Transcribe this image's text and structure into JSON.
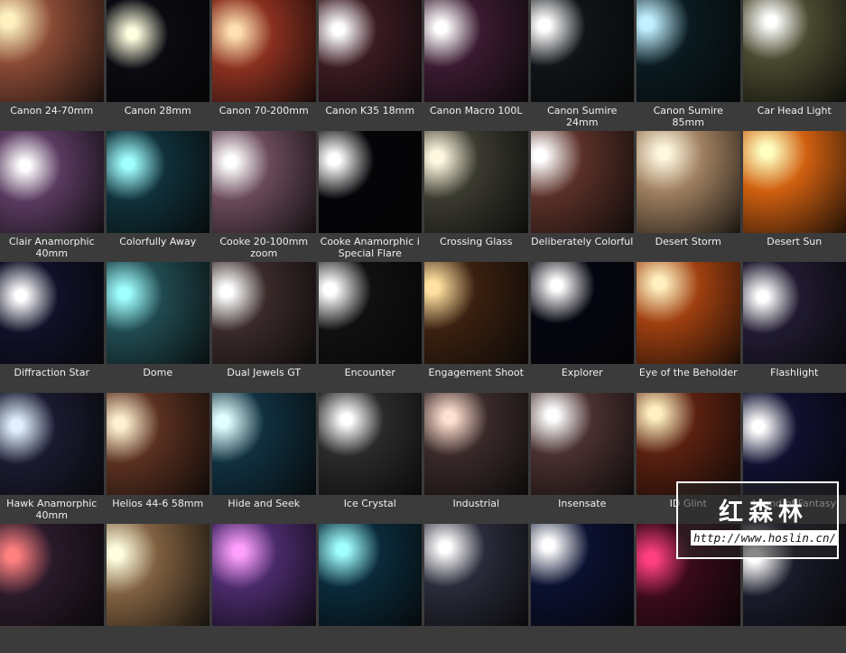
{
  "presets": [
    {
      "label": "Canon 24-70mm",
      "glow": "#fff2c0",
      "bg": "#8a4a35"
    },
    {
      "label": "Canon 28mm",
      "glow": "#ffffe0",
      "bg": "#0a0a10"
    },
    {
      "label": "Canon 70-200mm",
      "glow": "#ffe0b0",
      "bg": "#8a3020"
    },
    {
      "label": "Canon K35 18mm",
      "glow": "#ffffff",
      "bg": "#3a1a22"
    },
    {
      "label": "Canon Macro 100L",
      "glow": "#ffffff",
      "bg": "#3a1a30"
    },
    {
      "label": "Canon Sumire 24mm",
      "glow": "#ffffff",
      "bg": "#101418"
    },
    {
      "label": "Canon Sumire 85mm",
      "glow": "#c0f0ff",
      "bg": "#0a1a20"
    },
    {
      "label": "Car Head Light",
      "glow": "#ffffff",
      "bg": "#4a4a30"
    },
    {
      "label": "Clair Anamorphic 40mm",
      "glow": "#ffffff",
      "bg": "#5a3a60"
    },
    {
      "label": "Colorfully Away",
      "glow": "#a0ffff",
      "bg": "#10303a"
    },
    {
      "label": "Cooke 20-100mm zoom",
      "glow": "#ffffff",
      "bg": "#6a4a5a"
    },
    {
      "label": "Cooke Anamorphic i Special Flare",
      "glow": "#ffffff",
      "bg": "#050508"
    },
    {
      "label": "Crossing Glass",
      "glow": "#fff8e0",
      "bg": "#3a3a30"
    },
    {
      "label": "Deliberately Colorful",
      "glow": "#ffffff",
      "bg": "#5a3028"
    },
    {
      "label": "Desert Storm",
      "glow": "#fff8e0",
      "bg": "#a08060"
    },
    {
      "label": "Desert Sun",
      "glow": "#ffffc0",
      "bg": "#d06010"
    },
    {
      "label": "Diffraction Star",
      "glow": "#ffffff",
      "bg": "#101028"
    },
    {
      "label": "Dome",
      "glow": "#a0ffff",
      "bg": "#204a50"
    },
    {
      "label": "Dual Jewels GT",
      "glow": "#ffffff",
      "bg": "#3a2a2a"
    },
    {
      "label": "Encounter",
      "glow": "#ffffff",
      "bg": "#101010"
    },
    {
      "label": "Engagement Shoot",
      "glow": "#ffe0a0",
      "bg": "#3a2010"
    },
    {
      "label": "Explorer",
      "glow": "#ffffff",
      "bg": "#050510"
    },
    {
      "label": "Eye of the Beholder",
      "glow": "#fff0c0",
      "bg": "#a04010"
    },
    {
      "label": "Flashlight",
      "glow": "#ffffff",
      "bg": "#201a30"
    },
    {
      "label": "Hawk Anamorphic 40mm",
      "glow": "#e0f0ff",
      "bg": "#1a1a30"
    },
    {
      "label": "Helios 44-6 58mm",
      "glow": "#fff0d0",
      "bg": "#5a3020"
    },
    {
      "label": "Hide and Seek",
      "glow": "#e0ffff",
      "bg": "#103040"
    },
    {
      "label": "Ice Crystal",
      "glow": "#ffffff",
      "bg": "#2a2a2a"
    },
    {
      "label": "Industrial",
      "glow": "#ffe0d0",
      "bg": "#3a2a2a"
    },
    {
      "label": "Insensate",
      "glow": "#ffffff",
      "bg": "#4a3030"
    },
    {
      "label": "ID Glint",
      "glow": "#fff0c0",
      "bg": "#5a2010"
    },
    {
      "label": "Island of Fantasy",
      "glow": "#ffffff",
      "bg": "#101030"
    },
    {
      "label": "",
      "glow": "#ff8080",
      "bg": "#2a1a2a"
    },
    {
      "label": "",
      "glow": "#ffffe0",
      "bg": "#806040"
    },
    {
      "label": "",
      "glow": "#ffa0ff",
      "bg": "#4a2a6a"
    },
    {
      "label": "",
      "glow": "#a0ffff",
      "bg": "#0a2a3a"
    },
    {
      "label": "",
      "glow": "#ffffff",
      "bg": "#2a2a3a"
    },
    {
      "label": "",
      "glow": "#ffffff",
      "bg": "#0a1030"
    },
    {
      "label": "",
      "glow": "#ff4080",
      "bg": "#3a0a1a"
    },
    {
      "label": "",
      "glow": "#ffffff",
      "bg": "#1a1a2a"
    }
  ],
  "watermark": {
    "brand": "红森林",
    "url": "http://www.hoslin.cn/"
  }
}
